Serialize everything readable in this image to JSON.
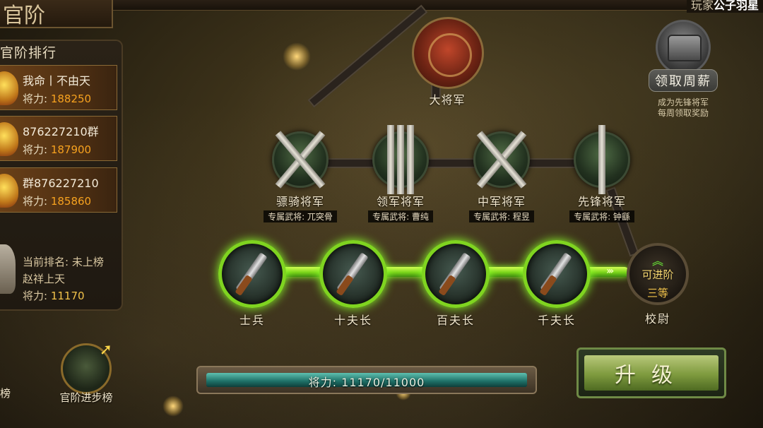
{
  "header": {
    "title": "官阶",
    "player_prefix": "玩家",
    "player_name": "公子羽星"
  },
  "ranking": {
    "title": "官阶排行",
    "items": [
      {
        "name": "我命丨不由天",
        "power_label": "将力:",
        "power": "188250"
      },
      {
        "name": "876227210群",
        "power_label": "将力:",
        "power": "187900"
      },
      {
        "name": "群876227210",
        "power_label": "将力:",
        "power": "185860"
      }
    ],
    "my": {
      "rank_text": "当前排名: 未上榜",
      "name": "赵祥上天",
      "power_label": "将力:",
      "power": "11170"
    }
  },
  "tiers": {
    "top": {
      "label": "大将军"
    },
    "middle": [
      {
        "label": "骠骑将军",
        "sub": "专属武将: 兀突骨"
      },
      {
        "label": "领军将军",
        "sub": "专属武将: 曹纯"
      },
      {
        "label": "中军将军",
        "sub": "专属武将: 程昱"
      },
      {
        "label": "先锋将军",
        "sub": "专属武将: 钟繇"
      }
    ],
    "lower": [
      {
        "label": "士兵"
      },
      {
        "label": "十夫长"
      },
      {
        "label": "百夫长"
      },
      {
        "label": "千夫长"
      }
    ],
    "next": {
      "tag": "可进阶",
      "rank": "三等",
      "label": "校尉"
    }
  },
  "chest": {
    "label": "领取周薪",
    "note_line1": "成为先锋将军",
    "note_line2": "每周领取奖励"
  },
  "progress": {
    "text": "将力: 11170/11000",
    "fraction": 1.0
  },
  "upgrade": {
    "label": "升级"
  },
  "bottom": {
    "advance_label": "官阶进步榜",
    "edge_label": "榜"
  }
}
